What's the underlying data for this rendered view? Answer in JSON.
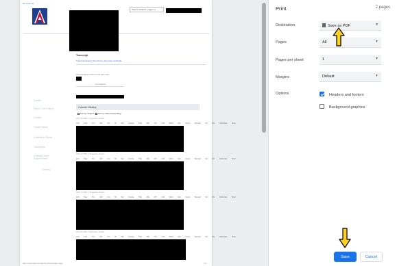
{
  "preview": {
    "top_link": "Go to Home",
    "search_placeholder": "Search students, pages, e",
    "transcript_heading": "Transcript",
    "tabs": "Transcript   History   Test Scores   Summary   Schedule",
    "cumulative_label": "Cumulative",
    "gpa_label": "GPA Weighted GPA    Credit Summary",
    "sidebar_links": [
      "Grades",
      "Report Card History",
      "Grades",
      "Grade History",
      "Graduation Status",
      "Transcripts",
      "College/Career Requirements",
      "Classes"
    ],
    "course_history": "Course History",
    "sort_by_subject": "Sort by Subject",
    "sort_by_date": "Sort by Date Descending",
    "table_header": "Grd Year Trm Sch Crs ID Std Course Title Mrk CIT Cit2 Work Hrs Comp Special Ind Dis Valid-date Mast",
    "year_labels": [
      "2017-18 CMS - Progressive Studies",
      "2016-17 CMS - Progressive Studies",
      "2015-16 CMS - Progressive Studies",
      "2014-15 CMS - Progressive Studies"
    ],
    "footer_url": "https://example.com/aeries/Transcripts.aspx",
    "page_num": "1/2"
  },
  "panel": {
    "title": "Print",
    "page_count": "2 pages",
    "destination_label": "Destination",
    "destination_value": "Save as PDF",
    "pages_label": "Pages",
    "pages_value": "All",
    "pages_per_sheet_label": "Pages per sheet",
    "pages_per_sheet_value": "1",
    "margins_label": "Margins",
    "margins_value": "Default",
    "options_label": "Options",
    "headers_footers": "Headers and footers",
    "headers_footers_checked": true,
    "background_graphics": "Background graphics",
    "background_graphics_checked": false,
    "save_label": "Save",
    "cancel_label": "Cancel"
  },
  "colors": {
    "accent": "#1a73e8",
    "arrow_fill": "#ffd21f",
    "logo_red": "#c8102e",
    "logo_blue": "#1f3f8f"
  },
  "icons": {
    "dropdown": "chevron-down-icon",
    "destination": "document-icon",
    "annotation": "arrow-icon"
  }
}
